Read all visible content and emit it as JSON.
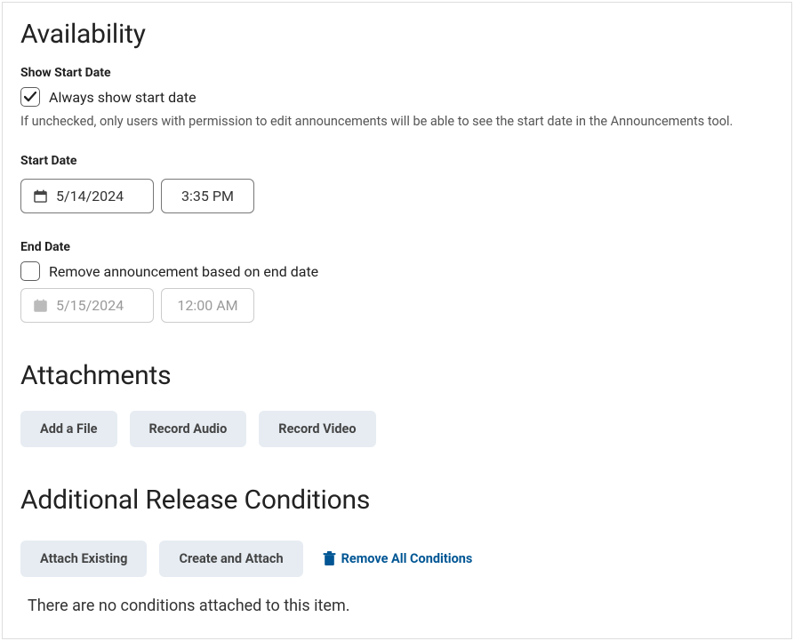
{
  "availability": {
    "heading": "Availability",
    "showStartDate": {
      "label": "Show Start Date",
      "checkboxLabel": "Always show start date",
      "checked": true,
      "help": "If unchecked, only users with permission to edit announcements will be able to see the start date in the Announcements tool."
    },
    "startDate": {
      "label": "Start Date",
      "date": "5/14/2024",
      "time": "3:35 PM",
      "enabled": true
    },
    "endDate": {
      "label": "End Date",
      "checkboxLabel": "Remove announcement based on end date",
      "checked": false,
      "date": "5/15/2024",
      "time": "12:00 AM",
      "enabled": false
    }
  },
  "attachments": {
    "heading": "Attachments",
    "addFile": "Add a File",
    "recordAudio": "Record Audio",
    "recordVideo": "Record Video"
  },
  "releaseConditions": {
    "heading": "Additional Release Conditions",
    "attachExisting": "Attach Existing",
    "createAttach": "Create and Attach",
    "removeAll": "Remove All Conditions",
    "emptyMessage": "There are no conditions attached to this item."
  }
}
